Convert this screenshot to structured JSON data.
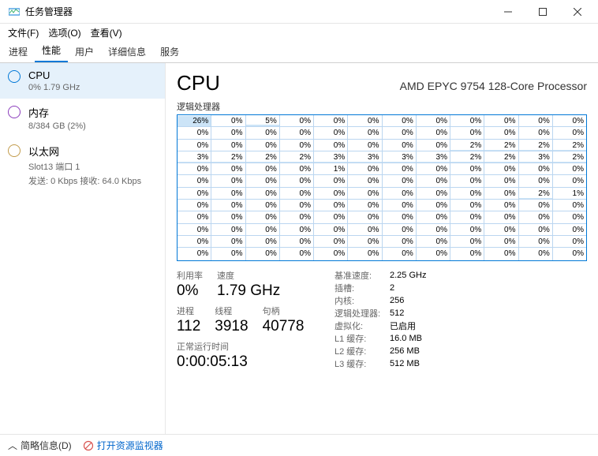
{
  "window": {
    "title": "任务管理器"
  },
  "menu": {
    "file": "文件(F)",
    "options": "选项(O)",
    "view": "查看(V)"
  },
  "tabs": [
    "进程",
    "性能",
    "用户",
    "详细信息",
    "服务"
  ],
  "active_tab": 1,
  "sidebar": {
    "items": [
      {
        "title": "CPU",
        "sub": "0% 1.79 GHz",
        "color": "#0078d7"
      },
      {
        "title": "内存",
        "sub": "8/384 GB (2%)",
        "color": "#8b3dbc"
      },
      {
        "title": "以太网",
        "sub": "Slot13 端口 1",
        "sub2": "发送: 0 Kbps 接收: 64.0 Kbps",
        "color": "#c29b4b"
      }
    ]
  },
  "main": {
    "heading": "CPU",
    "processor": "AMD EPYC 9754 128-Core Processor",
    "graph_label": "逻辑处理器",
    "cores_rows": [
      [
        26,
        0,
        5,
        0,
        0,
        0,
        0,
        0,
        0,
        0,
        0,
        0
      ],
      [
        0,
        0,
        0,
        0,
        0,
        0,
        0,
        0,
        0,
        0,
        0,
        0
      ],
      [
        0,
        0,
        0,
        0,
        0,
        0,
        0,
        0,
        2,
        2,
        2,
        2
      ],
      [
        3,
        2,
        2,
        2,
        3,
        3,
        3,
        3,
        2,
        2,
        3,
        2
      ],
      [
        0,
        0,
        0,
        0,
        1,
        0,
        0,
        0,
        0,
        0,
        0,
        0
      ],
      [
        0,
        0,
        0,
        0,
        0,
        0,
        0,
        0,
        0,
        0,
        0,
        0
      ],
      [
        0,
        0,
        0,
        0,
        0,
        0,
        0,
        0,
        0,
        0,
        2,
        1
      ],
      [
        0,
        0,
        0,
        0,
        0,
        0,
        0,
        0,
        0,
        0,
        0,
        0
      ],
      [
        0,
        0,
        0,
        0,
        0,
        0,
        0,
        0,
        0,
        0,
        0,
        0
      ],
      [
        0,
        0,
        0,
        0,
        0,
        0,
        0,
        0,
        0,
        0,
        0,
        0
      ],
      [
        0,
        0,
        0,
        0,
        0,
        0,
        0,
        0,
        0,
        0,
        0,
        0
      ],
      [
        0,
        0,
        0,
        0,
        0,
        0,
        0,
        0,
        0,
        0,
        0,
        0
      ]
    ],
    "stats_left": {
      "util_label": "利用率",
      "util_value": "0%",
      "speed_label": "速度",
      "speed_value": "1.79 GHz",
      "proc_label": "进程",
      "proc_value": "112",
      "thread_label": "线程",
      "thread_value": "3918",
      "handle_label": "句柄",
      "handle_value": "40778",
      "uptime_label": "正常运行时间",
      "uptime_value": "0:00:05:13"
    },
    "stats_right": [
      {
        "l": "基准速度:",
        "v": "2.25 GHz"
      },
      {
        "l": "插槽:",
        "v": "2"
      },
      {
        "l": "内核:",
        "v": "256"
      },
      {
        "l": "逻辑处理器:",
        "v": "512"
      },
      {
        "l": "虚拟化:",
        "v": "已启用"
      },
      {
        "l": "L1 缓存:",
        "v": "16.0 MB"
      },
      {
        "l": "L2 缓存:",
        "v": "256 MB"
      },
      {
        "l": "L3 缓存:",
        "v": "512 MB"
      }
    ]
  },
  "footer": {
    "fewer": "简略信息(D)",
    "resmon": "打开资源监视器"
  }
}
